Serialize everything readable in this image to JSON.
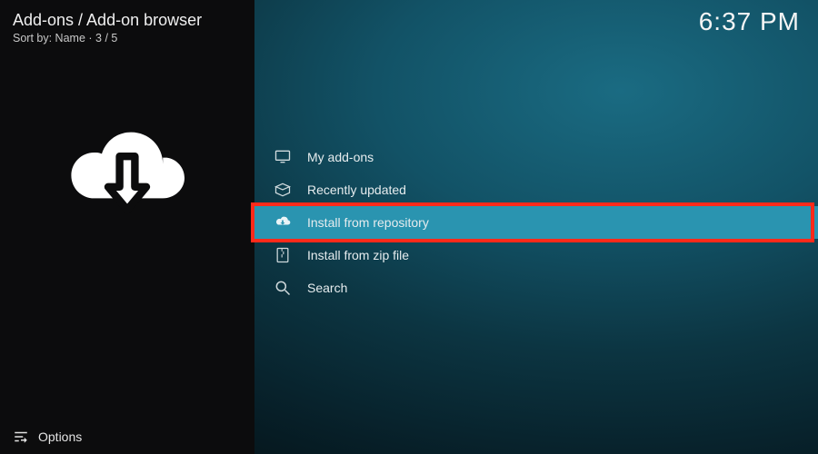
{
  "header": {
    "breadcrumb": "Add-ons / Add-on browser",
    "sort_prefix": "Sort by: ",
    "sort_value": "Name",
    "position": "3 / 5"
  },
  "clock": "6:37 PM",
  "menu": {
    "items": [
      {
        "label": "My add-ons"
      },
      {
        "label": "Recently updated"
      },
      {
        "label": "Install from repository"
      },
      {
        "label": "Install from zip file"
      },
      {
        "label": "Search"
      }
    ]
  },
  "footer": {
    "options_label": "Options"
  },
  "colors": {
    "highlight": "#ff2a1a",
    "selected_bg": "#2a94b0"
  }
}
